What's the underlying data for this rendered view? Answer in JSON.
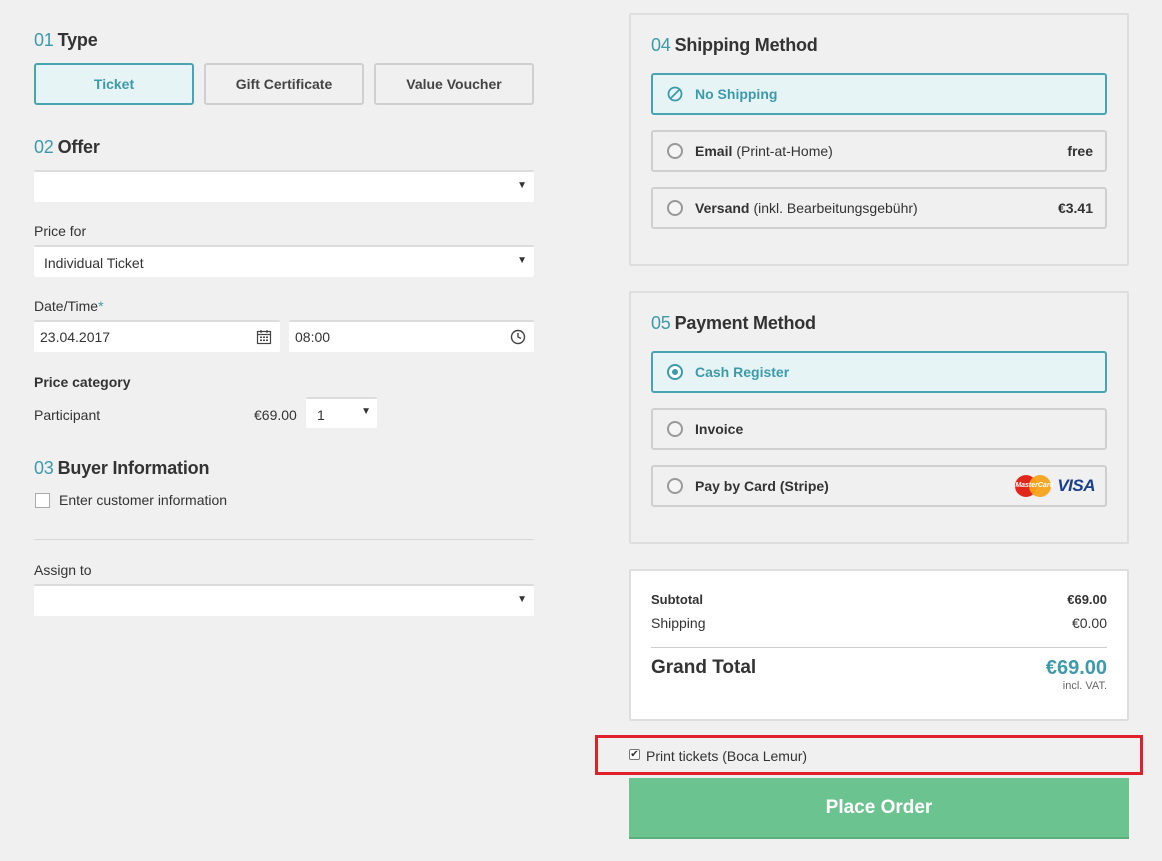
{
  "type_section": {
    "num": "01",
    "title": "Type",
    "buttons": [
      "Ticket",
      "Gift Certificate",
      "Value Voucher"
    ]
  },
  "offer_section": {
    "num": "02",
    "title": "Offer",
    "offer_value": ""
  },
  "price_for": {
    "label": "Price for",
    "value": "Individual Ticket"
  },
  "date_time": {
    "label": "Date/Time",
    "required_mark": "*",
    "date": "23.04.2017",
    "time": "08:00"
  },
  "price_category": {
    "label": "Price category",
    "participant_label": "Participant",
    "participant_price": "€69.00",
    "quantity": "1"
  },
  "buyer_section": {
    "num": "03",
    "title": "Buyer Information",
    "checkbox_label": "Enter customer information"
  },
  "assign": {
    "label": "Assign to",
    "value": ""
  },
  "shipping": {
    "num": "04",
    "title": "Shipping Method",
    "options": [
      {
        "name": "No Shipping",
        "detail": "",
        "price": ""
      },
      {
        "name": "Email",
        "detail": "(Print-at-Home)",
        "price": "free"
      },
      {
        "name": "Versand",
        "detail": "(inkl. Bearbeitungsgebühr)",
        "price": "€3.41"
      }
    ]
  },
  "payment": {
    "num": "05",
    "title": "Payment Method",
    "options": [
      "Cash Register",
      "Invoice",
      "Pay by Card (Stripe)"
    ],
    "card_brands": {
      "mastercard": "MasterCard",
      "visa": "VISA"
    }
  },
  "summary": {
    "subtotal_label": "Subtotal",
    "subtotal_value": "€69.00",
    "shipping_label": "Shipping",
    "shipping_value": "€0.00",
    "grand_total_label": "Grand Total",
    "grand_total_value": "€69.00",
    "vat_note": "incl. VAT."
  },
  "print_tickets": {
    "label": "Print tickets (Boca Lemur)",
    "checked": true
  },
  "place_order_label": "Place Order",
  "colors": {
    "accent": "#3d9aab",
    "place_order": "#6bc48f",
    "highlight": "#e0202a"
  }
}
